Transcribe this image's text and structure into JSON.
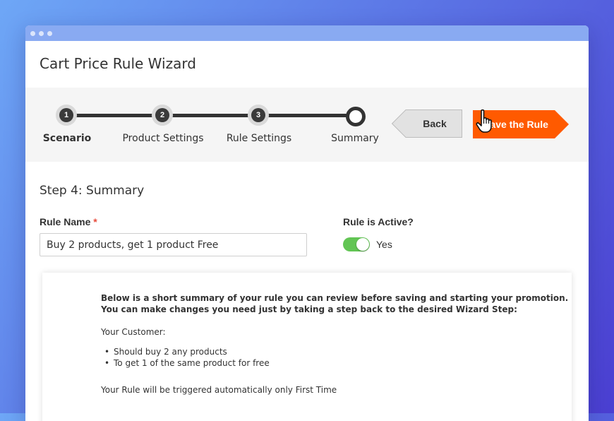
{
  "window": {
    "title": "Cart Price Rule Wizard"
  },
  "wizard": {
    "steps": [
      {
        "number": "1",
        "label": "Scenario",
        "state": "done"
      },
      {
        "number": "2",
        "label": "Product Settings",
        "state": "done"
      },
      {
        "number": "3",
        "label": "Rule Settings",
        "state": "done"
      },
      {
        "number": "",
        "label": "Summary",
        "state": "current"
      }
    ],
    "back_label": "Back",
    "save_label": "Save the Rule"
  },
  "form": {
    "section_title": "Step 4: Summary",
    "rule_name_label": "Rule Name",
    "required_mark": "*",
    "rule_name_value": "Buy 2 products, get 1 product Free",
    "active_label": "Rule is Active?",
    "active_value": "Yes",
    "active_on": true
  },
  "summary": {
    "intro_line1": "Below is a short summary of your rule you can review before saving and starting your promotion.",
    "intro_line2": "You can make changes you need just by taking a step back to the desired Wizard Step:",
    "customer_heading": "Your Customer:",
    "items": [
      "Should buy 2 any products",
      "To get 1 of the same product for free"
    ],
    "trigger_text": "Your Rule will be triggered automatically only First Time"
  },
  "colors": {
    "accent": "#ff5a00",
    "toggle_on": "#62c554",
    "titlebar": "#89aaf2"
  }
}
